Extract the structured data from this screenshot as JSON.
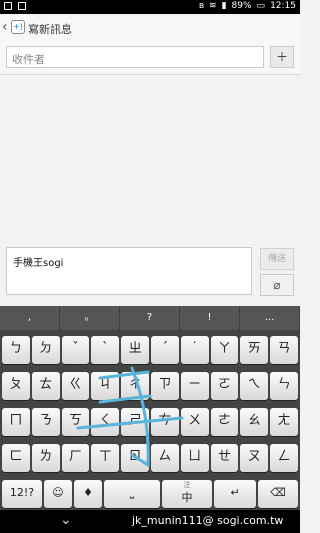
{
  "status_bar": {
    "battery": "89%",
    "time": "12:15"
  },
  "action_bar": {
    "title": "寫新訊息",
    "app_icon_text": "+)"
  },
  "recipient": {
    "placeholder": "收件者",
    "add_icon": "person-add-icon"
  },
  "compose": {
    "text": "手機王sogi",
    "send_label": "傳送",
    "attach_icon": "paperclip-icon"
  },
  "keyboard": {
    "punct": [
      ",",
      "。",
      "?",
      "!",
      "..."
    ],
    "row1": [
      "ㄅ",
      "ㄉ",
      "ˇ",
      "ˋ",
      "ㄓ",
      "ˊ",
      "˙",
      "ㄚ",
      "ㄞ",
      "ㄢ"
    ],
    "row2": [
      "ㄆ",
      "ㄊ",
      "ㄍ",
      "ㄐ",
      "ㄔ",
      "ㄗ",
      "ㄧ",
      "ㄛ",
      "ㄟ",
      "ㄣ"
    ],
    "row3": [
      "ㄇ",
      "ㄋ",
      "ㄎ",
      "ㄑ",
      "ㄕ",
      "ㄘ",
      "ㄨ",
      "ㄜ",
      "ㄠ",
      "ㄤ"
    ],
    "row4": [
      "ㄈ",
      "ㄌ",
      "ㄏ",
      "ㄒ",
      "ㄖ",
      "ㄙ",
      "ㄩ",
      "ㄝ",
      "ㄡ",
      "ㄥ"
    ],
    "bottom": {
      "mode": "12!?",
      "emoji_icon": "smiley-icon",
      "mic_icon": "mic-icon",
      "space": "⎵",
      "lang_top": "注",
      "lang": "中",
      "enter_icon": "enter-icon",
      "backspace_icon": "backspace-icon"
    }
  },
  "watermark": "jk_munin111@ sogi.com.tw"
}
